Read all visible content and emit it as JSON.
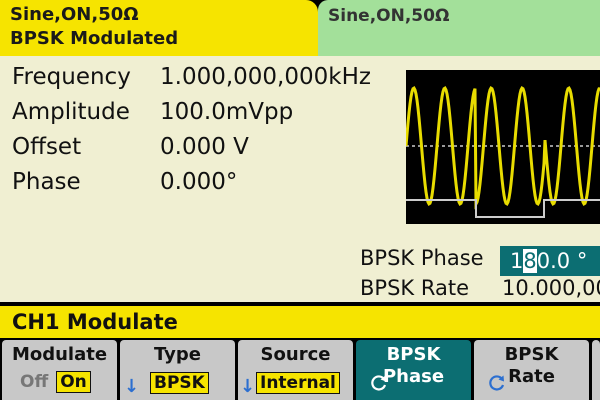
{
  "tabs": {
    "ch1": {
      "line1": "Sine,ON,50Ω",
      "line2": "BPSK Modulated"
    },
    "ch2": {
      "line1": "Sine,ON,50Ω"
    }
  },
  "params": [
    {
      "label": "Frequency",
      "value": "1.000,000,000kHz"
    },
    {
      "label": "Amplitude",
      "value": "100.0mVpp"
    },
    {
      "label": "Offset",
      "value": "0.000 V"
    },
    {
      "label": "Phase",
      "value": "0.000°"
    }
  ],
  "bpsk": {
    "phase_label": "BPSK Phase",
    "phase_value_pre": "1",
    "phase_value_cursor": "8",
    "phase_value_post": "0.0 °",
    "rate_label": "BPSK Rate",
    "rate_value": "10.000,000"
  },
  "section": {
    "title": "CH1 Modulate"
  },
  "softkeys": {
    "modulate": {
      "title": "Modulate",
      "off": "Off",
      "on": "On"
    },
    "type": {
      "title": "Type",
      "value": "BPSK"
    },
    "source": {
      "title": "Source",
      "value": "Internal"
    },
    "bpsk_phase": {
      "line1": "BPSK",
      "line2": "Phase"
    },
    "bpsk_rate": {
      "line1": "BPSK",
      "line2": "Rate"
    }
  },
  "colors": {
    "active_tab": "#f6e400",
    "inactive_tab": "#a3e09a",
    "panel": "#f0efd2",
    "teal": "#0c6e72",
    "wave": "#e8dc00"
  }
}
